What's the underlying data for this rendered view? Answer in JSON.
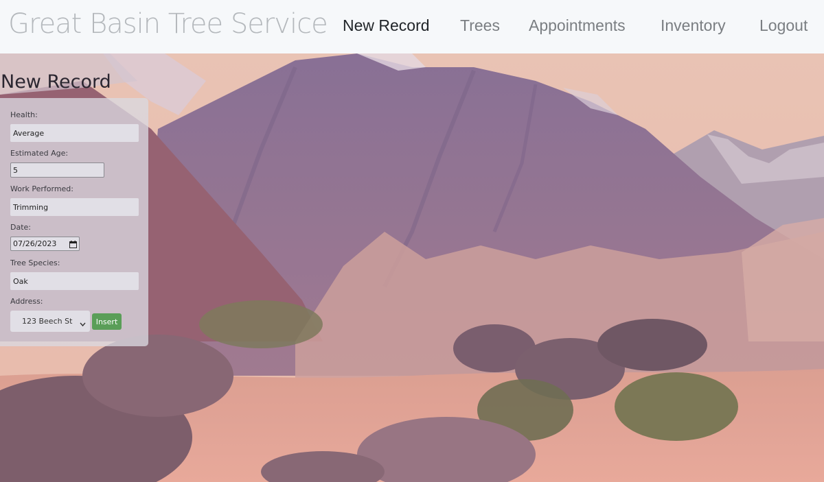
{
  "navbar": {
    "brand": "Great Basin Tree Service",
    "links": [
      {
        "label": "New Record",
        "active": true
      },
      {
        "label": "Trees",
        "active": false
      },
      {
        "label": "Appointments",
        "active": false
      },
      {
        "label": "Inventory",
        "active": false
      },
      {
        "label": "Logout",
        "active": false
      }
    ]
  },
  "page": {
    "heading": "New Record"
  },
  "form": {
    "health": {
      "label": "Health:",
      "value": "Average"
    },
    "estimated_age": {
      "label": "Estimated Age:",
      "value": "5"
    },
    "work_performed": {
      "label": "Work Performed:",
      "value": "Trimming"
    },
    "date": {
      "label": "Date:",
      "value": "07/26/2023"
    },
    "tree_species": {
      "label": "Tree Species:",
      "value": "Oak"
    },
    "address": {
      "label": "Address:",
      "selected": "123 Beech St"
    },
    "insert_label": "Insert"
  },
  "colors": {
    "navbar_bg": "#f6f8fa",
    "brand_text": "#b4b8bc",
    "nav_link": "#7a7e82",
    "nav_link_active": "#212529",
    "insert_button": "#5a9e58",
    "form_panel": "#dad8e0"
  },
  "icons": {
    "date_picker": "calendar-icon",
    "select_arrow": "chevron-down-icon"
  }
}
